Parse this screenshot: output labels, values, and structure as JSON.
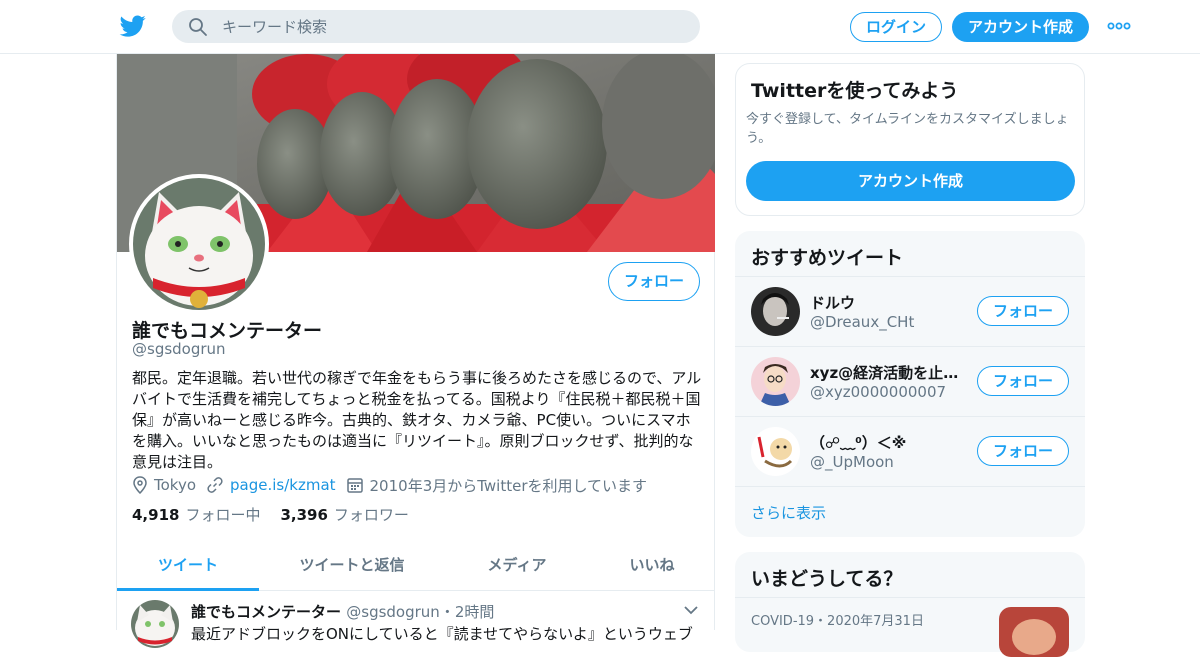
{
  "header": {
    "search_placeholder": "キーワード検索",
    "login_label": "ログイン",
    "signup_label": "アカウント作成"
  },
  "profile": {
    "name": "誰でもコメンテーター",
    "handle": "@sgsdogrun",
    "follow_label": "フォロー",
    "bio": "都民。定年退職。若い世代の稼ぎで年金をもらう事に後ろめたさを感じるので、アルバイトで生活費を補完してちょっと税金を払ってる。国税より『住民税＋都民税＋国保』が高いねーと感じる昨今。古典的、鉄オタ、カメラ爺、PC使い。ついにスマホを購入。いいなと思ったものは適当に『リツイート』。原則ブロックせず、批判的な意見は注目。",
    "location": "Tokyo",
    "url": "page.is/kzmat",
    "joined": "2010年3月からTwitterを利用しています",
    "following_count": "4,918",
    "following_label": "フォロー中",
    "followers_count": "3,396",
    "followers_label": "フォロワー"
  },
  "tabs": [
    {
      "label": "ツイート",
      "active": true
    },
    {
      "label": "ツイートと返信",
      "active": false
    },
    {
      "label": "メディア",
      "active": false
    },
    {
      "label": "いいね",
      "active": false
    }
  ],
  "tweet": {
    "name": "誰でもコメンテーター",
    "handle": "@sgsdogrun",
    "time": "・2時間",
    "body": "最近アドブロックをONにしていると『読ませてやらないよ』というウェブ"
  },
  "signup_card": {
    "title": "Twitterを使ってみよう",
    "desc": "今すぐ登録して、タイムラインをカスタマイズしましょう。",
    "button": "アカウント作成"
  },
  "recommendations": {
    "title": "おすすめツイート",
    "items": [
      {
        "name": "ドルウ",
        "handle": "@Dreaux_CHt",
        "button": "フォロー"
      },
      {
        "name": "xyz@経済活動を止めるな",
        "handle": "@xyz0000000007",
        "button": "フォロー"
      },
      {
        "name": "（☍﹏⁰）＜※",
        "handle": "@_UpMoon",
        "button": "フォロー"
      }
    ],
    "show_more": "さらに表示"
  },
  "trends": {
    "title": "いまどうしてる？",
    "item_meta": "COVID-19・2020年7月31日"
  },
  "colors": {
    "accent": "#1da1f2",
    "link": "#1b95e0",
    "muted": "#657786",
    "text": "#14171a"
  }
}
